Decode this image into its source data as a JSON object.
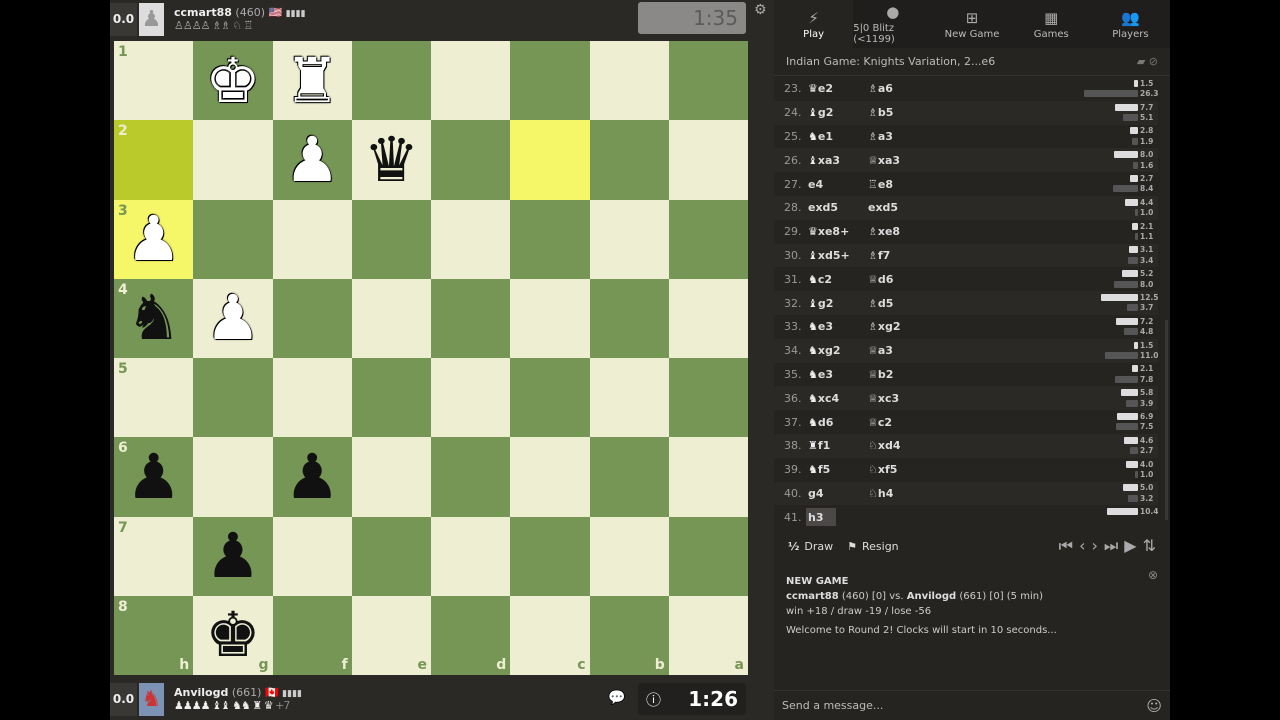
{
  "top_player": {
    "score": "0.0",
    "name": "ccmart88",
    "rating": "(460)",
    "flag": "🇺🇸",
    "captured": "♙♙♙♙ ♗♗ ♘ ♖",
    "clock": "1:35"
  },
  "bottom_player": {
    "score": "0.0",
    "name": "Anvilogd",
    "rating": "(661)",
    "flag": "🇨🇦",
    "captured": "♟♟♟♟ ♝♝ ♞♞ ♜ ♛",
    "plus": "+7",
    "clock": "1:26"
  },
  "board": {
    "orientation": "black",
    "ranks": [
      "1",
      "2",
      "3",
      "4",
      "5",
      "6",
      "7",
      "8"
    ],
    "files": [
      "h",
      "g",
      "f",
      "e",
      "d",
      "c",
      "b",
      "a"
    ],
    "highlights": [
      "h2",
      "c2",
      "h3"
    ],
    "pieces": [
      {
        "sq": "g1",
        "p": "K",
        "c": "w"
      },
      {
        "sq": "f1",
        "p": "R",
        "c": "w"
      },
      {
        "sq": "f2",
        "p": "P",
        "c": "w"
      },
      {
        "sq": "e2",
        "p": "Q",
        "c": "b"
      },
      {
        "sq": "h3",
        "p": "P",
        "c": "w"
      },
      {
        "sq": "h4",
        "p": "N",
        "c": "b"
      },
      {
        "sq": "g4",
        "p": "P",
        "c": "w"
      },
      {
        "sq": "h6",
        "p": "P",
        "c": "b"
      },
      {
        "sq": "f6",
        "p": "P",
        "c": "b"
      },
      {
        "sq": "g7",
        "p": "P",
        "c": "b"
      },
      {
        "sq": "g8",
        "p": "K",
        "c": "b"
      }
    ]
  },
  "nav": [
    {
      "label": "Play",
      "icon": "lightning-icon",
      "glyph": "⚡"
    },
    {
      "label": "5|0 Blitz (<1199)",
      "icon": "medal-icon",
      "glyph": "●"
    },
    {
      "label": "New Game",
      "icon": "plus-square-icon",
      "glyph": "⊞"
    },
    {
      "label": "Games",
      "icon": "checkerboard-icon",
      "glyph": "▦"
    },
    {
      "label": "Players",
      "icon": "users-icon",
      "glyph": "👥"
    }
  ],
  "opening": "Indian Game: Knights Variation, 2...e6",
  "moves": [
    {
      "n": "23.",
      "w": "Q",
      "ws": "e2",
      "b": "B",
      "bs": "a6",
      "ew": "1.5",
      "eb": "26.3"
    },
    {
      "n": "24.",
      "w": "B",
      "ws": "g2",
      "b": "B",
      "bs": "b5",
      "ew": "7.7",
      "eb": "5.1"
    },
    {
      "n": "25.",
      "w": "N",
      "ws": "e1",
      "b": "B",
      "bs": "a3",
      "ew": "2.8",
      "eb": "1.9"
    },
    {
      "n": "26.",
      "w": "B",
      "ws": "xa3",
      "b": "Q",
      "bs": "xa3",
      "ew": "8.0",
      "eb": "1.6"
    },
    {
      "n": "27.",
      "w": "",
      "ws": "e4",
      "b": "R",
      "bs": "e8",
      "ew": "2.7",
      "eb": "8.4"
    },
    {
      "n": "28.",
      "w": "",
      "ws": "exd5",
      "b": "",
      "bs": "exd5",
      "ew": "4.4",
      "eb": "1.0"
    },
    {
      "n": "29.",
      "w": "Q",
      "ws": "xe8+",
      "b": "B",
      "bs": "xe8",
      "ew": "2.1",
      "eb": "1.1"
    },
    {
      "n": "30.",
      "w": "B",
      "ws": "xd5+",
      "b": "B",
      "bs": "f7",
      "ew": "3.1",
      "eb": "3.4"
    },
    {
      "n": "31.",
      "w": "N",
      "ws": "c2",
      "b": "Q",
      "bs": "d6",
      "ew": "5.2",
      "eb": "8.0"
    },
    {
      "n": "32.",
      "w": "B",
      "ws": "g2",
      "b": "B",
      "bs": "d5",
      "ew": "12.5",
      "eb": "3.7"
    },
    {
      "n": "33.",
      "w": "N",
      "ws": "e3",
      "b": "B",
      "bs": "xg2",
      "ew": "7.2",
      "eb": "4.8"
    },
    {
      "n": "34.",
      "w": "N",
      "ws": "xg2",
      "b": "Q",
      "bs": "a3",
      "ew": "1.5",
      "eb": "11.0"
    },
    {
      "n": "35.",
      "w": "N",
      "ws": "e3",
      "b": "Q",
      "bs": "b2",
      "ew": "2.1",
      "eb": "7.8"
    },
    {
      "n": "36.",
      "w": "N",
      "ws": "xc4",
      "b": "Q",
      "bs": "xc3",
      "ew": "5.8",
      "eb": "3.9"
    },
    {
      "n": "37.",
      "w": "N",
      "ws": "d6",
      "b": "Q",
      "bs": "c2",
      "ew": "6.9",
      "eb": "7.5"
    },
    {
      "n": "38.",
      "w": "R",
      "ws": "f1",
      "b": "N",
      "bs": "xd4",
      "ew": "4.6",
      "eb": "2.7"
    },
    {
      "n": "39.",
      "w": "N",
      "ws": "f5",
      "b": "N",
      "bs": "xf5",
      "ew": "4.0",
      "eb": "1.0"
    },
    {
      "n": "40.",
      "w": "",
      "ws": "g4",
      "b": "N",
      "bs": "h4",
      "ew": "5.0",
      "eb": "3.2"
    },
    {
      "n": "41.",
      "w": "",
      "ws": "h3",
      "b": "",
      "bs": "",
      "ew": "10.4",
      "eb": ""
    }
  ],
  "controls": {
    "draw": "Draw",
    "draw_icon": "½",
    "resign": "Resign"
  },
  "chat": {
    "title": "NEW GAME",
    "p1": "ccmart88",
    "p1_info": "(460) [0] vs.",
    "p2": "Anvilogd",
    "p2_info": "(661) [0] (5 min)",
    "stakes": "win +18 / draw -19 / lose -56",
    "welcome": "Welcome to Round 2! Clocks will start in 10 seconds...",
    "placeholder": "Send a message..."
  },
  "colors": {
    "light_square": "#eeeed2",
    "dark_square": "#769656",
    "highlight": "#f6f669"
  }
}
